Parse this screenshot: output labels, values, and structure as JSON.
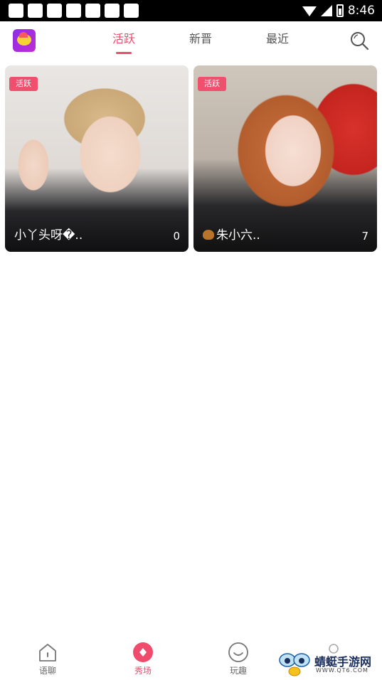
{
  "status_bar": {
    "time": "8:46",
    "icons": [
      "wifi-icon",
      "signal-icon",
      "battery-icon"
    ]
  },
  "top_nav": {
    "logo_icon": "app-logo-icon",
    "tabs": [
      {
        "label": "活跃",
        "active": true
      },
      {
        "label": "新晋",
        "active": false
      },
      {
        "label": "最近",
        "active": false
      }
    ],
    "search_icon": "search-icon"
  },
  "cards": [
    {
      "badge": "活跃",
      "name": "小丫头呀�..",
      "count": "0"
    },
    {
      "badge": "活跃",
      "name": "朱小六..",
      "count": "7"
    }
  ],
  "bottom_nav": {
    "items": [
      {
        "label": "语聊",
        "icon": "house-icon",
        "active": false
      },
      {
        "label": "秀场",
        "icon": "diamond-icon",
        "active": true
      },
      {
        "label": "玩趣",
        "icon": "smile-icon",
        "active": false
      },
      {
        "label": "",
        "icon": "person-icon",
        "active": false
      }
    ]
  },
  "watermark": {
    "text": "蜻蜓手游网",
    "url": "WWW.QT6.COM"
  },
  "colors": {
    "accent": "#f04a6c",
    "status_bar": "#000000",
    "text_inactive": "#555555"
  }
}
